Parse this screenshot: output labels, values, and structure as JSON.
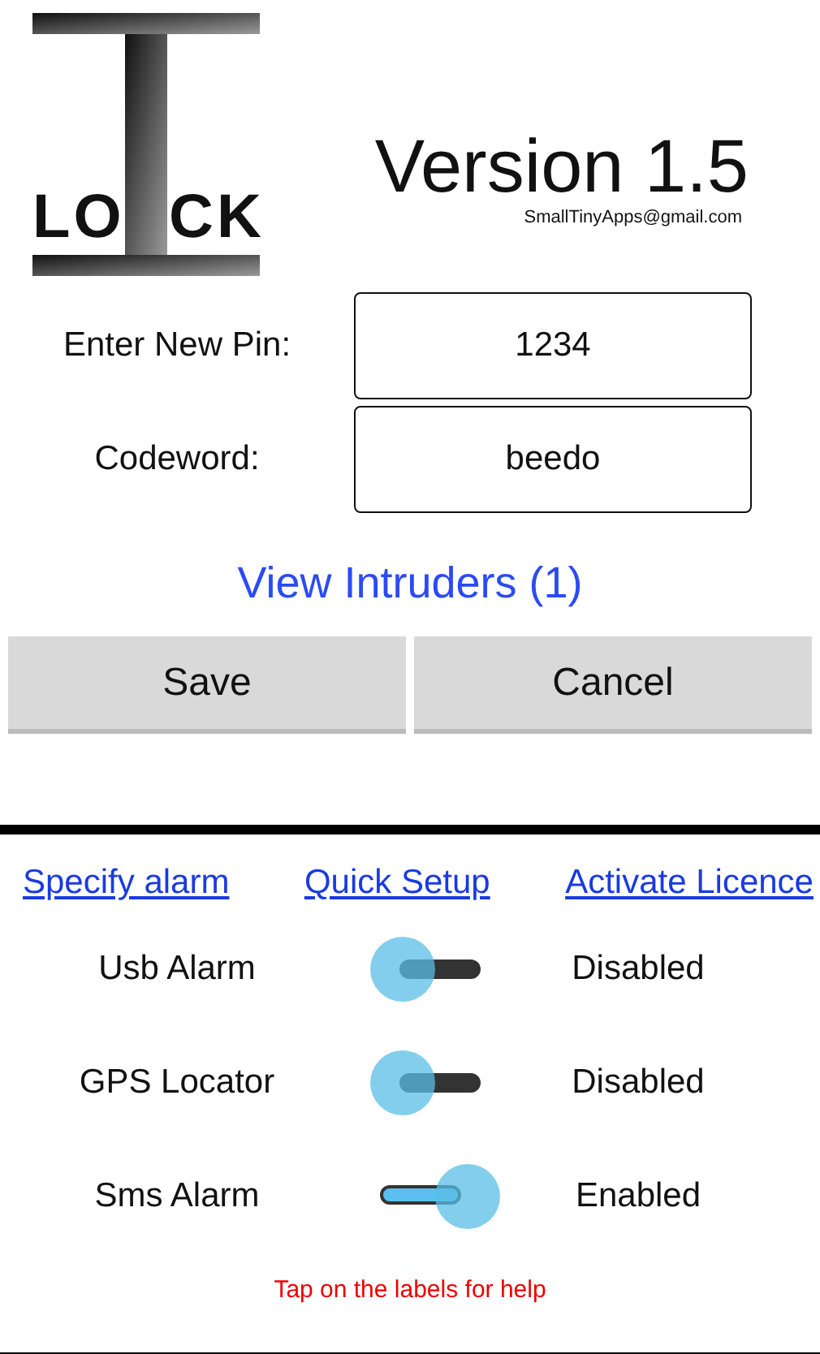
{
  "logo": {
    "left": "LO",
    "right": "CK"
  },
  "version": "Version 1.5",
  "email": "SmallTinyApps@gmail.com",
  "fields": [
    {
      "label": "Enter New Pin:",
      "value": "1234"
    },
    {
      "label": "Codeword:",
      "value": "beedo"
    }
  ],
  "intruders_link": "View Intruders (1)",
  "buttons": [
    "Save",
    "Cancel"
  ],
  "links": [
    "Specify alarm",
    "Quick Setup",
    "Activate Licence"
  ],
  "alarms": [
    {
      "label": "Usb Alarm",
      "on": false,
      "status": "Disabled"
    },
    {
      "label": "GPS Locator",
      "on": false,
      "status": "Disabled"
    },
    {
      "label": "Sms Alarm",
      "on": true,
      "status": "Enabled"
    }
  ],
  "help": "Tap on the labels for help"
}
